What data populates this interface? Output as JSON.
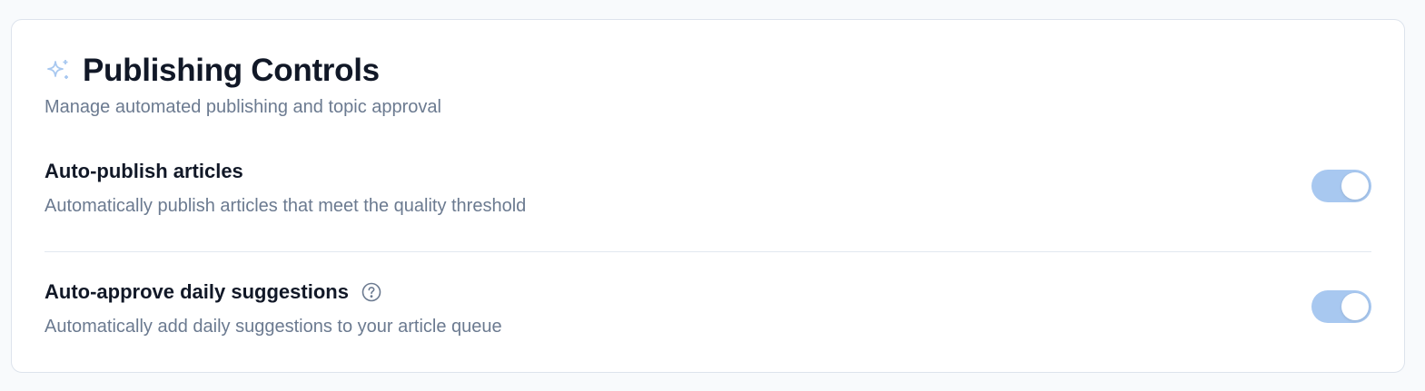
{
  "card": {
    "icon": "sparkle-icon",
    "title": "Publishing Controls",
    "subtitle": "Manage automated publishing and topic approval"
  },
  "settings": [
    {
      "title": "Auto-publish articles",
      "description": "Automatically publish articles that meet the quality threshold",
      "enabled": true
    },
    {
      "title": "Auto-approve daily suggestions",
      "description": "Automatically add daily suggestions to your article queue",
      "help_icon": "question-circle-icon",
      "enabled": true
    }
  ],
  "colors": {
    "toggle_on": "#a8c8f0",
    "icon": "#a8c8f0",
    "title": "#111827",
    "muted": "#6b7a90"
  }
}
